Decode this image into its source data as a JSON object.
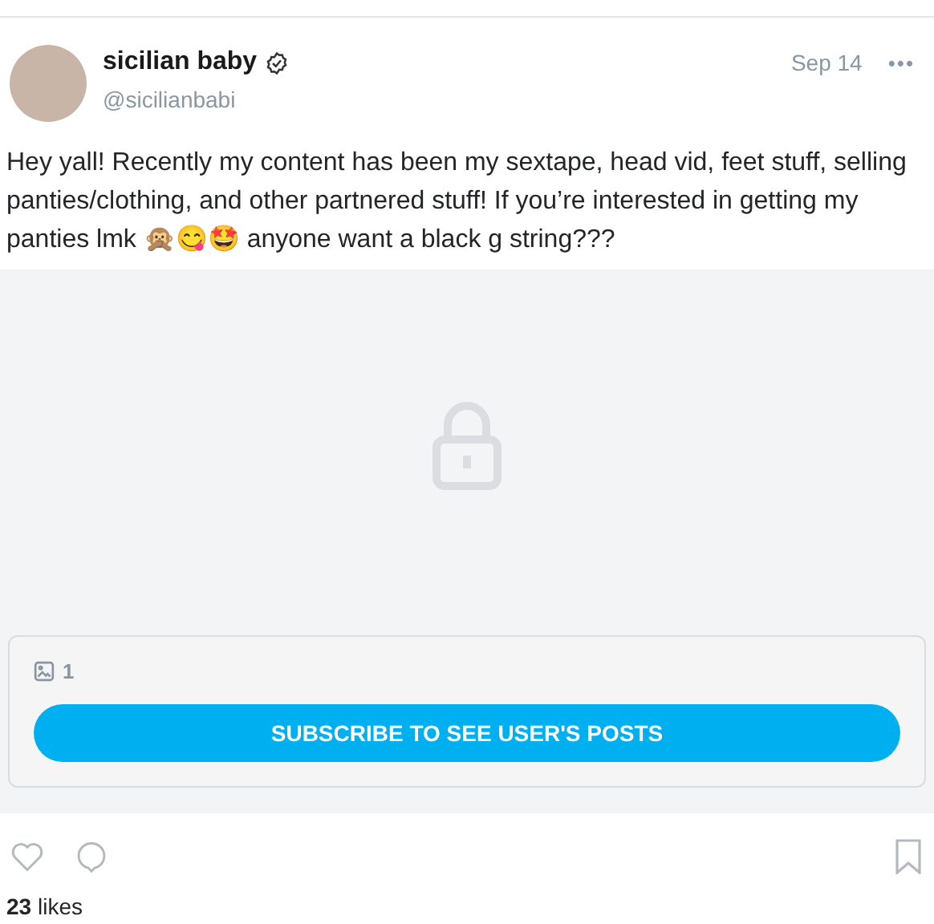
{
  "post": {
    "author_name": "sicilian baby",
    "verified": true,
    "handle": "@sicilianbabi",
    "date": "Sep 14",
    "more": "•••",
    "text": "Hey yall! Recently my content has been my sextape, head vid, feet stuff, selling panties/clothing, and other partnered stuff! If you’re interested in getting my panties lmk 🙊😋🤩 anyone want a black g string???",
    "media": {
      "locked": true,
      "count": "1",
      "button": "SUBSCRIBE TO SEE USER'S POSTS"
    },
    "liked": false,
    "saved": false,
    "likes": "**23** likes"
  }
}
